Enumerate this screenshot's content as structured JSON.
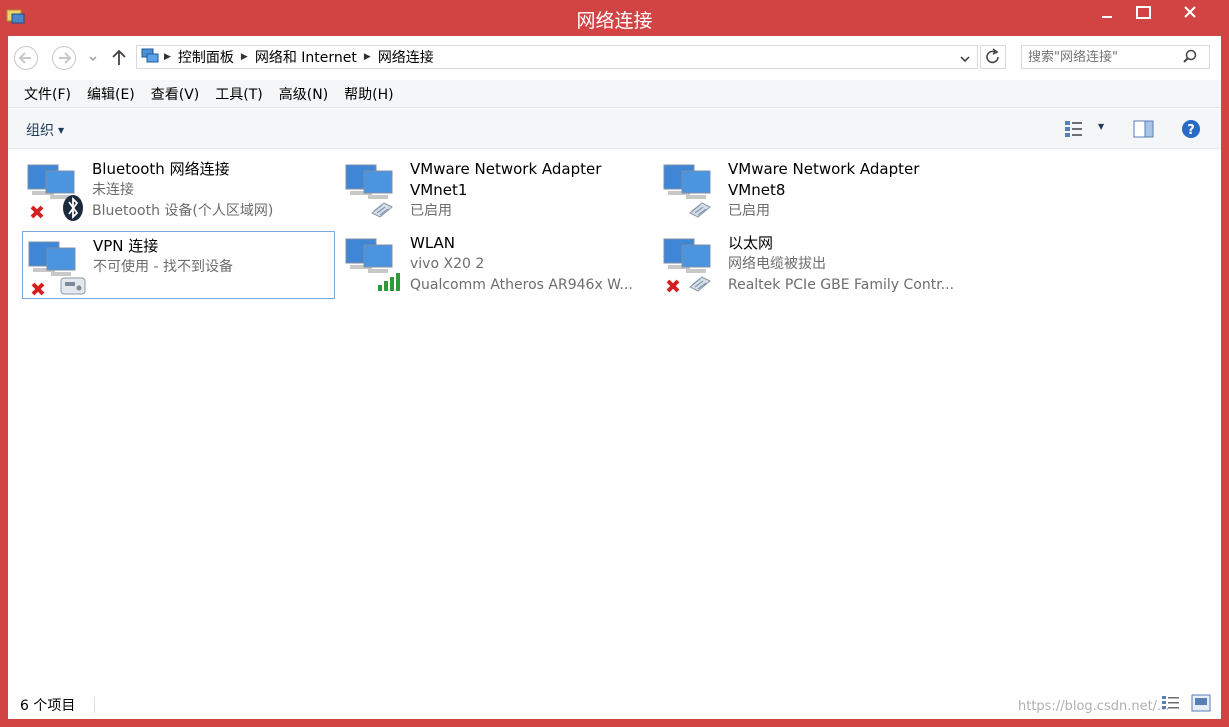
{
  "window": {
    "title": "网络连接"
  },
  "address": {
    "crumbs": [
      "控制面板",
      "网络和 Internet",
      "网络连接"
    ]
  },
  "search": {
    "placeholder": "搜索\"网络连接\""
  },
  "menu": [
    "文件(F)",
    "编辑(E)",
    "查看(V)",
    "工具(T)",
    "高级(N)",
    "帮助(H)"
  ],
  "command": {
    "organize": "组织"
  },
  "items": [
    {
      "name": "Bluetooth 网络连接",
      "line2": "未连接",
      "line3": "Bluetooth 设备(个人区域网)",
      "icon": "bluetooth-disconnected"
    },
    {
      "name": "VMware Network Adapter",
      "line2": "VMnet1",
      "line3": "已启用",
      "icon": "ethernet"
    },
    {
      "name": "VMware Network Adapter",
      "line2": "VMnet8",
      "line3": "已启用",
      "icon": "ethernet"
    },
    {
      "name": "VPN 连接",
      "line2": "不可使用 - 找不到设备",
      "line3": "",
      "icon": "vpn-disconnected"
    },
    {
      "name": "WLAN",
      "line2": "vivo X20  2",
      "line3": "Qualcomm Atheros AR946x W...",
      "icon": "wifi"
    },
    {
      "name": "以太网",
      "line2": "网络电缆被拔出",
      "line3": "Realtek PCIe GBE Family Contr...",
      "icon": "ethernet-disconnected"
    }
  ],
  "status": {
    "count": "6 个项目",
    "watermark": "https://blog.csdn.net/..."
  },
  "colors": {
    "titlebar": "#d24444",
    "selection_border": "#7aa8d8"
  }
}
